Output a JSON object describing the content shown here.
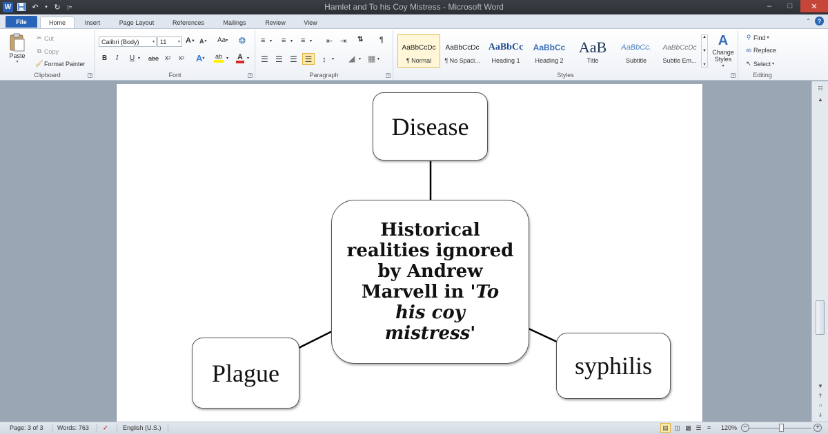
{
  "window": {
    "title": "Hamlet and To his Coy Mistress  -  Microsoft Word"
  },
  "qat": {
    "app_icon_label": "W",
    "customize_label": "|="
  },
  "tabs": [
    {
      "label": "File"
    },
    {
      "label": "Home"
    },
    {
      "label": "Insert"
    },
    {
      "label": "Page Layout"
    },
    {
      "label": "References"
    },
    {
      "label": "Mailings"
    },
    {
      "label": "Review"
    },
    {
      "label": "View"
    }
  ],
  "ribbon": {
    "clipboard": {
      "group_label": "Clipboard",
      "paste": "Paste",
      "cut": "Cut",
      "copy": "Copy",
      "format_painter": "Format Painter"
    },
    "font": {
      "group_label": "Font",
      "font_name": "Calibri (Body)",
      "font_size": "11",
      "grow": "A",
      "shrink": "A",
      "case": "Aa",
      "bold": "B",
      "italic": "I",
      "underline": "U",
      "strike": "abe",
      "subscript": "x",
      "superscript": "x",
      "text_effects": "A",
      "highlight": "ab",
      "font_color": "A",
      "font_color_hex": "#d42a1f",
      "highlight_hex": "#fff200"
    },
    "paragraph": {
      "group_label": "Paragraph"
    },
    "styles": {
      "group_label": "Styles",
      "items": [
        {
          "preview": "AaBbCcDc",
          "name": "¶ Normal"
        },
        {
          "preview": "AaBbCcDc",
          "name": "¶ No Spaci..."
        },
        {
          "preview": "AaBbCc",
          "name": "Heading 1"
        },
        {
          "preview": "AaBbCc",
          "name": "Heading 2"
        },
        {
          "preview": "AaB",
          "name": "Title"
        },
        {
          "preview": "AaBbCc.",
          "name": "Subtitle"
        },
        {
          "preview": "AaBbCcDc",
          "name": "Subtle Em..."
        }
      ],
      "change_styles": "Change Styles"
    },
    "editing": {
      "group_label": "Editing",
      "find": "Find",
      "replace": "Replace",
      "select": "Select"
    }
  },
  "diagram": {
    "top": "Disease",
    "center_line1": "Historical",
    "center_line2": "realities ignored",
    "center_line3": "by Andrew",
    "center_line4_a": "Marvell in '",
    "center_line4_b": "To",
    "center_line5": "his coy",
    "center_line6": "mistress'",
    "left": "Plague",
    "right": "syphilis"
  },
  "status": {
    "page": "Page: 3 of 3",
    "words": "Words: 763",
    "language": "English (U.S.)",
    "zoom": "120%",
    "zoom_percent": 120
  }
}
